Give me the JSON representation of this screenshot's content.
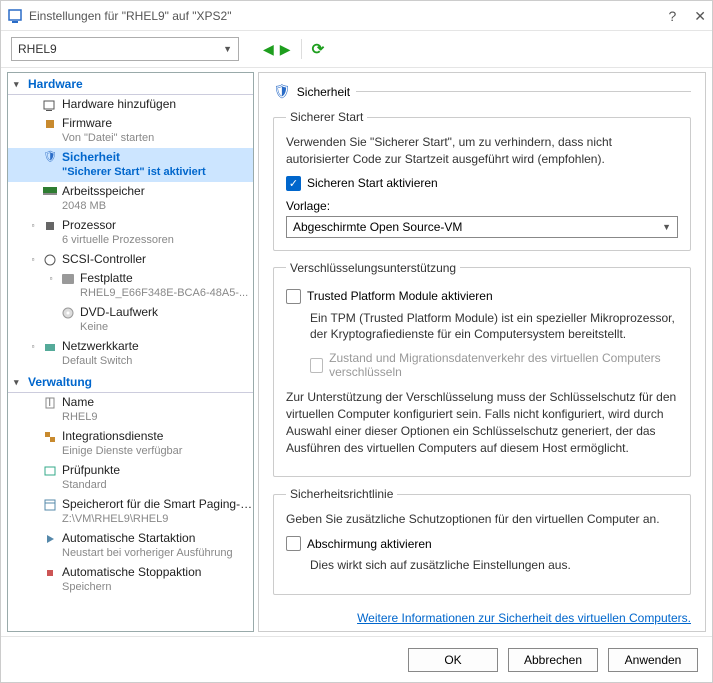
{
  "window": {
    "title": "Einstellungen für \"RHEL9\" auf \"XPS2\""
  },
  "toolbar": {
    "vm_name": "RHEL9"
  },
  "tree": {
    "cat_hardware": "Hardware",
    "cat_management": "Verwaltung",
    "add_hw": "Hardware hinzufügen",
    "firmware": {
      "label": "Firmware",
      "sub": "Von \"Datei\" starten"
    },
    "security": {
      "label": "Sicherheit",
      "sub": "\"Sicherer Start\" ist aktiviert"
    },
    "memory": {
      "label": "Arbeitsspeicher",
      "sub": "2048 MB"
    },
    "processor": {
      "label": "Prozessor",
      "sub": "6 virtuelle Prozessoren"
    },
    "scsi": {
      "label": "SCSI-Controller"
    },
    "hdd": {
      "label": "Festplatte",
      "sub": "RHEL9_E66F348E-BCA6-48A5-..."
    },
    "dvd": {
      "label": "DVD-Laufwerk",
      "sub": "Keine"
    },
    "nic": {
      "label": "Netzwerkkarte",
      "sub": "Default Switch"
    },
    "name": {
      "label": "Name",
      "sub": "RHEL9"
    },
    "integration": {
      "label": "Integrationsdienste",
      "sub": "Einige Dienste verfügbar"
    },
    "checkpoints": {
      "label": "Prüfpunkte",
      "sub": "Standard"
    },
    "smartpaging": {
      "label": "Speicherort für die Smart Paging-D...",
      "sub": "Z:\\VM\\RHEL9\\RHEL9"
    },
    "autostart": {
      "label": "Automatische Startaktion",
      "sub": "Neustart bei vorheriger Ausführung"
    },
    "autostop": {
      "label": "Automatische Stoppaktion",
      "sub": "Speichern"
    }
  },
  "panel": {
    "title": "Sicherheit",
    "secureboot": {
      "legend": "Sicherer Start",
      "desc": "Verwenden Sie \"Sicherer Start\", um zu verhindern, dass nicht autorisierter Code zur Startzeit ausgeführt wird (empfohlen).",
      "enable": "Sicheren Start aktivieren",
      "template_label": "Vorlage:",
      "template_value": "Abgeschirmte Open Source-VM"
    },
    "encryption": {
      "legend": "Verschlüsselungsunterstützung",
      "tpm_enable": "Trusted Platform Module aktivieren",
      "tpm_desc": "Ein TPM (Trusted Platform Module) ist ein spezieller Mikroprozessor, der Kryptografiedienste für ein Computersystem bereitstellt.",
      "migration_enable": "Zustand und Migrationsdatenverkehr des virtuellen Computers verschlüsseln",
      "support_note": "Zur Unterstützung der Verschlüsselung muss der Schlüsselschutz für den virtuellen Computer konfiguriert sein. Falls nicht konfiguriert, wird durch Auswahl einer dieser Optionen ein Schlüsselschutz generiert, der das Ausführen des virtuellen Computers auf diesem Host ermöglicht."
    },
    "policy": {
      "legend": "Sicherheitsrichtlinie",
      "desc": "Geben Sie zusätzliche Schutzoptionen für den virtuellen Computer an.",
      "shielding": "Abschirmung aktivieren",
      "note": "Dies wirkt sich auf zusätzliche Einstellungen aus."
    },
    "link": "Weitere Informationen zur Sicherheit des virtuellen Computers."
  },
  "buttons": {
    "ok": "OK",
    "cancel": "Abbrechen",
    "apply": "Anwenden"
  }
}
